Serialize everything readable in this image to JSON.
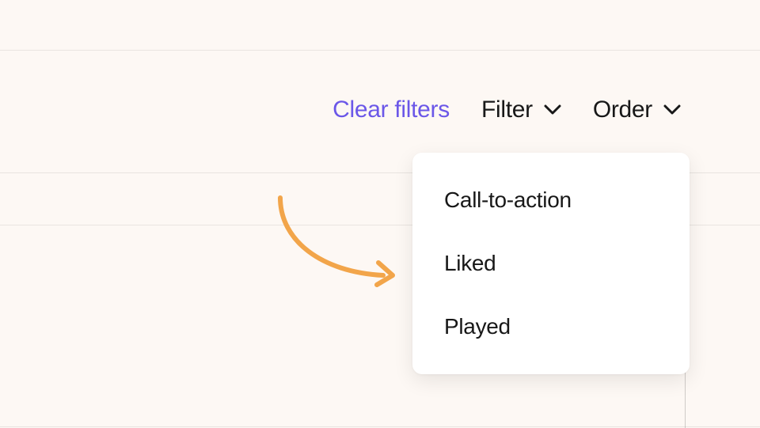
{
  "toolbar": {
    "clear_filters_label": "Clear filters",
    "filter_label": "Filter",
    "order_label": "Order"
  },
  "filter_menu": {
    "items": [
      {
        "label": "Call-to-action"
      },
      {
        "label": "Liked"
      },
      {
        "label": "Played"
      }
    ]
  },
  "colors": {
    "accent": "#6b57e8",
    "annotation_arrow": "#f2a54a",
    "text": "#181818",
    "bg": "#fdf8f4"
  }
}
